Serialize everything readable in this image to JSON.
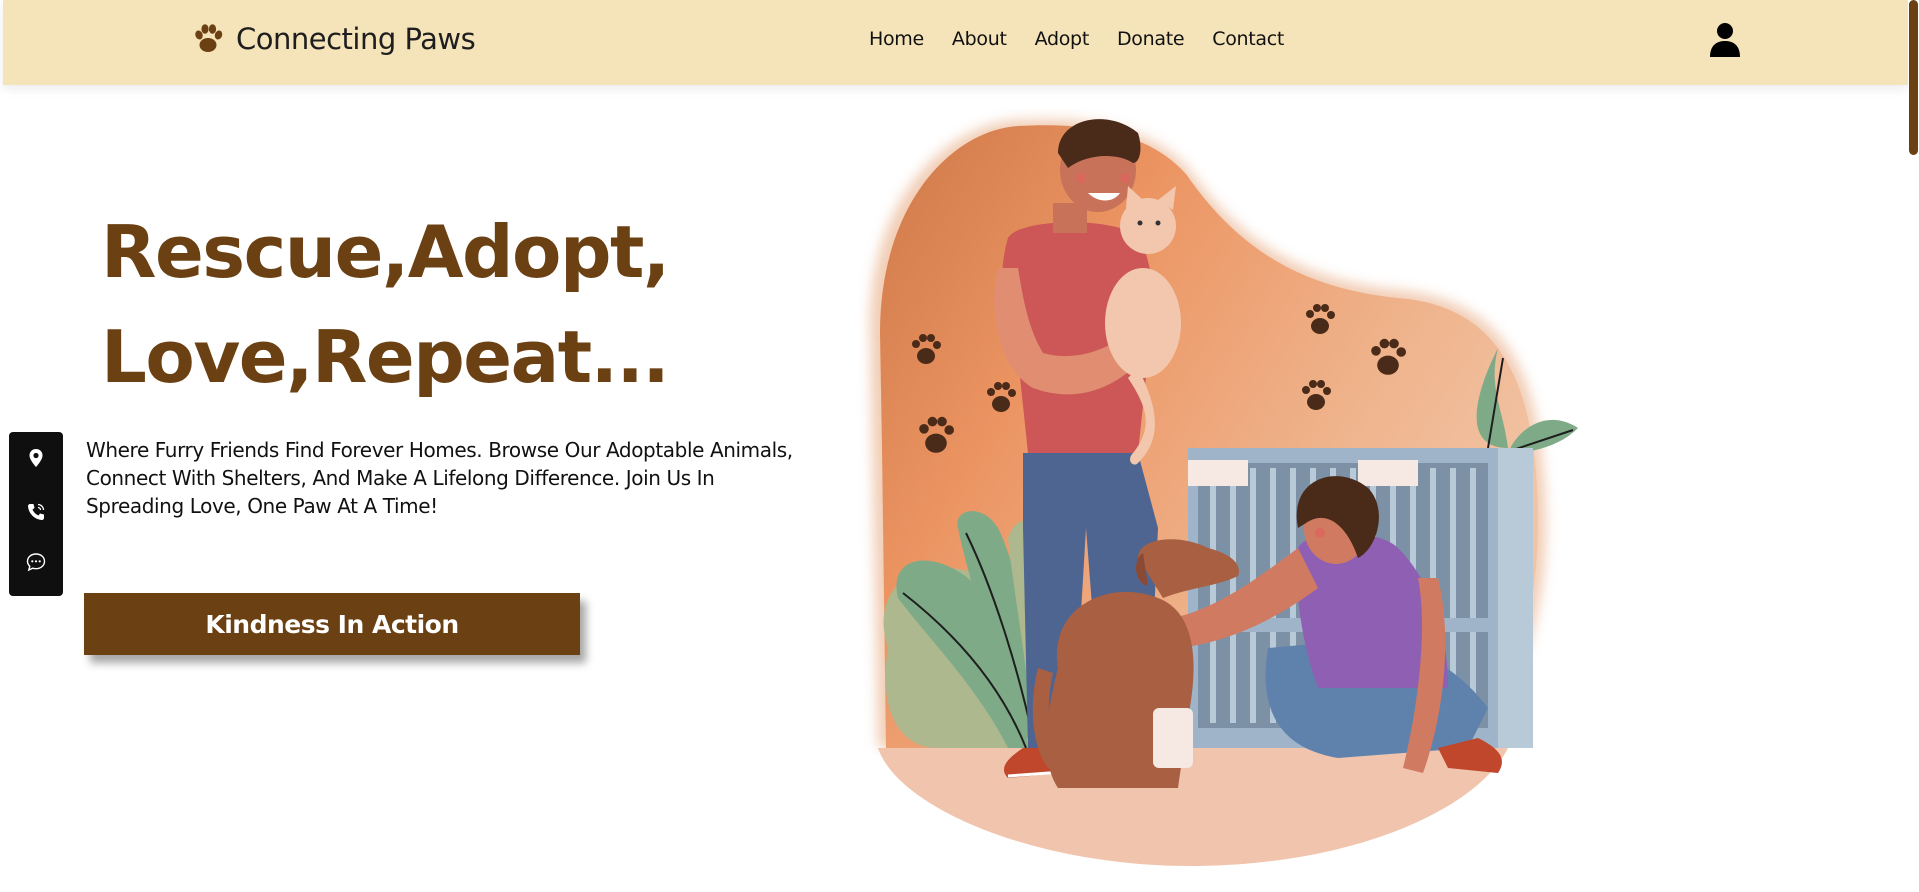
{
  "brand": {
    "name": "Connecting Paws",
    "icon": "paw-icon"
  },
  "nav": {
    "items": [
      "Home",
      "About",
      "Adopt",
      "Donate",
      "Contact"
    ]
  },
  "user": {
    "icon": "user-icon"
  },
  "hero": {
    "title_line1": "Rescue,Adopt,",
    "title_line2": "Love,Repeat...",
    "description": "Where Furry Friends Find Forever Homes. Browse Our Adoptable Animals, Connect With Shelters, And Make A Lifelong Difference. Join Us In Spreading Love, One Paw At A Time!",
    "cta_label": "Kindness In Action"
  },
  "sidebar": {
    "icons": [
      "location-pin-icon",
      "phone-icon",
      "chat-icon"
    ]
  },
  "colors": {
    "header_bg": "#f5e4b9",
    "accent_brown": "#6b4113",
    "sidebar_bg": "#0f0f0f"
  }
}
